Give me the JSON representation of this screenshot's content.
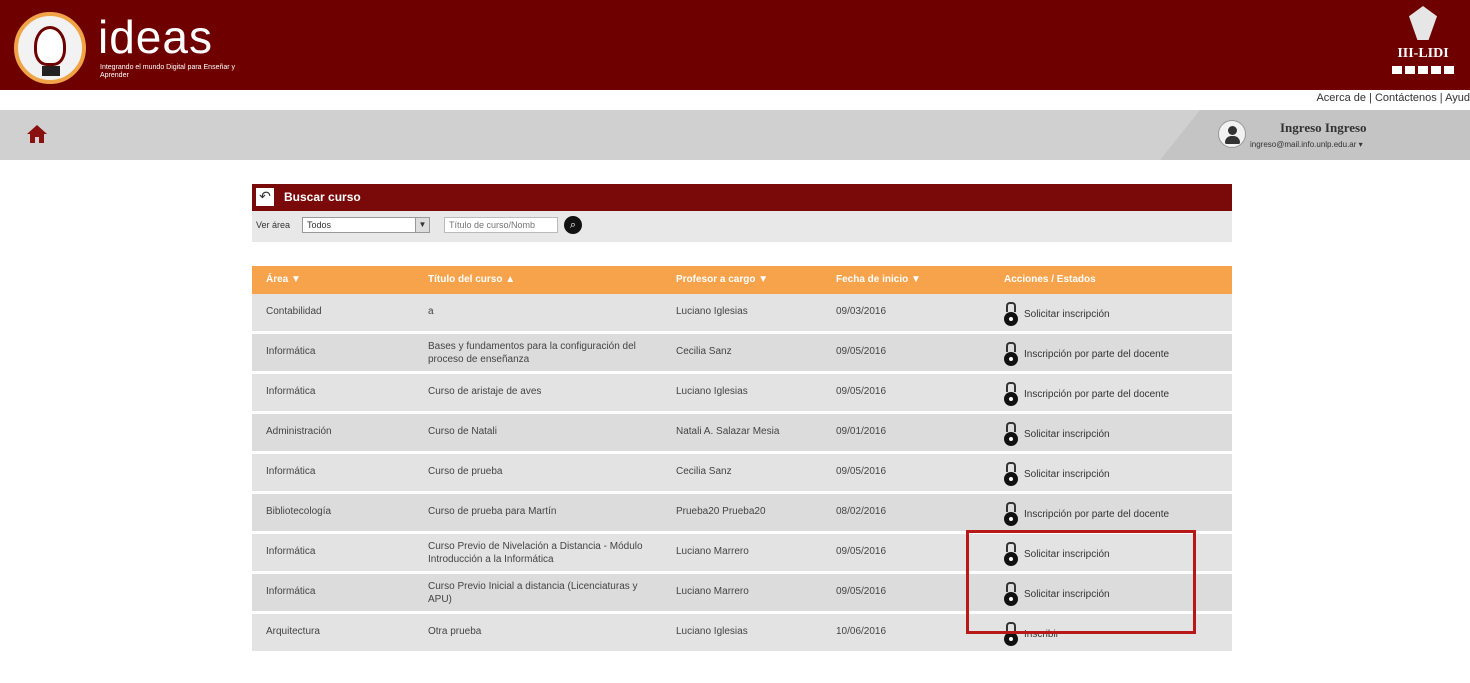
{
  "header": {
    "logo_text": "ideas",
    "logo_subtitle": "Integrando el mundo Digital para Enseñar y Aprender",
    "partner_text": "III-LIDI"
  },
  "top_links": {
    "about": "Acerca de",
    "contact": "Contáctenos",
    "help": "Ayud"
  },
  "user": {
    "name": "Ingreso Ingreso",
    "email": "ingreso@mail.info.unlp.edu.ar ▾"
  },
  "search": {
    "title": "Buscar curso",
    "area_label": "Ver área",
    "area_selected": "Todos",
    "input_placeholder": "Título de curso/Nomb"
  },
  "table": {
    "headers": [
      "Área ▼",
      "Título del curso ▲",
      "Profesor a cargo ▼",
      "Fecha de inicio ▼",
      "Acciones / Estados"
    ],
    "rows": [
      {
        "area": "Contabilidad",
        "title": "a",
        "professor": "Luciano Iglesias",
        "date": "09/03/2016",
        "action": "Solicitar inscripción"
      },
      {
        "area": "Informática",
        "title": "Bases y fundamentos para la configuración del proceso de enseñanza",
        "professor": "Cecilia Sanz",
        "date": "09/05/2016",
        "action": "Inscripción por parte del docente"
      },
      {
        "area": "Informática",
        "title": "Curso de aristaje de aves",
        "professor": "Luciano Iglesias",
        "date": "09/05/2016",
        "action": "Inscripción por parte del docente"
      },
      {
        "area": "Administración",
        "title": "Curso de Natali",
        "professor": "Natali A. Salazar Mesia",
        "date": "09/01/2016",
        "action": "Solicitar inscripción"
      },
      {
        "area": "Informática",
        "title": "Curso de prueba",
        "professor": "Cecilia Sanz",
        "date": "09/05/2016",
        "action": "Solicitar inscripción"
      },
      {
        "area": "Bibliotecología",
        "title": "Curso de prueba para Martín",
        "professor": "Prueba20 Prueba20",
        "date": "08/02/2016",
        "action": "Inscripción por parte del docente"
      },
      {
        "area": "Informática",
        "title": "Curso Previo de Nivelación a Distancia - Módulo Introducción a la Informática",
        "professor": "Luciano Marrero",
        "date": "09/05/2016",
        "action": "Solicitar inscripción"
      },
      {
        "area": "Informática",
        "title": "Curso Previo Inicial a distancia (Licenciaturas y APU)",
        "professor": "Luciano Marrero",
        "date": "09/05/2016",
        "action": "Solicitar inscripción"
      },
      {
        "area": "Arquitectura",
        "title": "Otra prueba",
        "professor": "Luciano Iglesias",
        "date": "10/06/2016",
        "action": "Inscribir"
      }
    ]
  }
}
